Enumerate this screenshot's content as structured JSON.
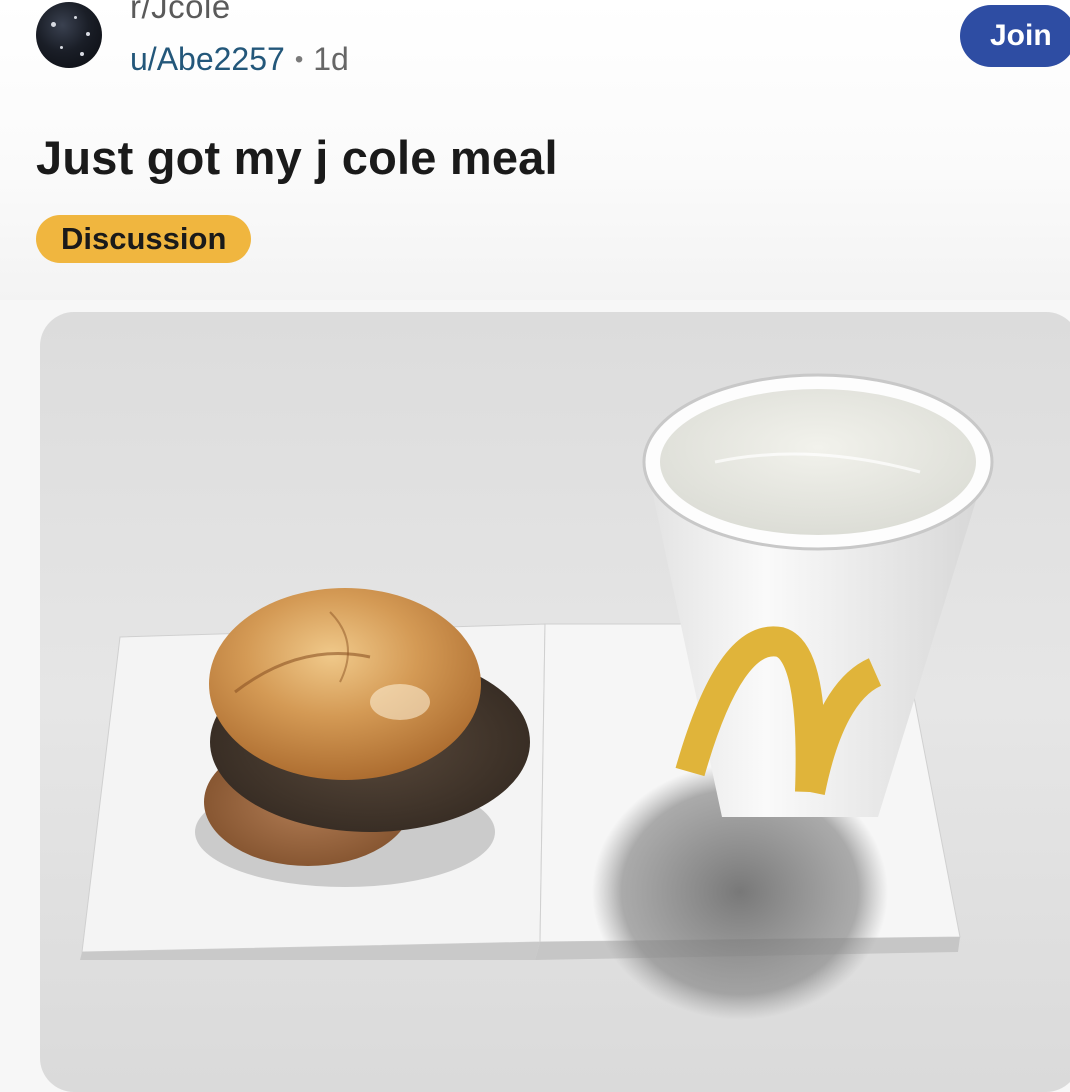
{
  "post": {
    "subreddit": "r/Jcole",
    "author": "u/Abe2257",
    "separator": "•",
    "age": "1d",
    "join_label": "Join",
    "title": "Just got my j cole meal",
    "flair": "Discussion"
  },
  "colors": {
    "join_button": "#2e4da3",
    "flair_background": "#f0b63f",
    "author_link": "#23577a"
  },
  "media": {
    "content": "photo",
    "icons": [
      "community-avatar",
      "burger-photo",
      "cup-photo"
    ]
  }
}
